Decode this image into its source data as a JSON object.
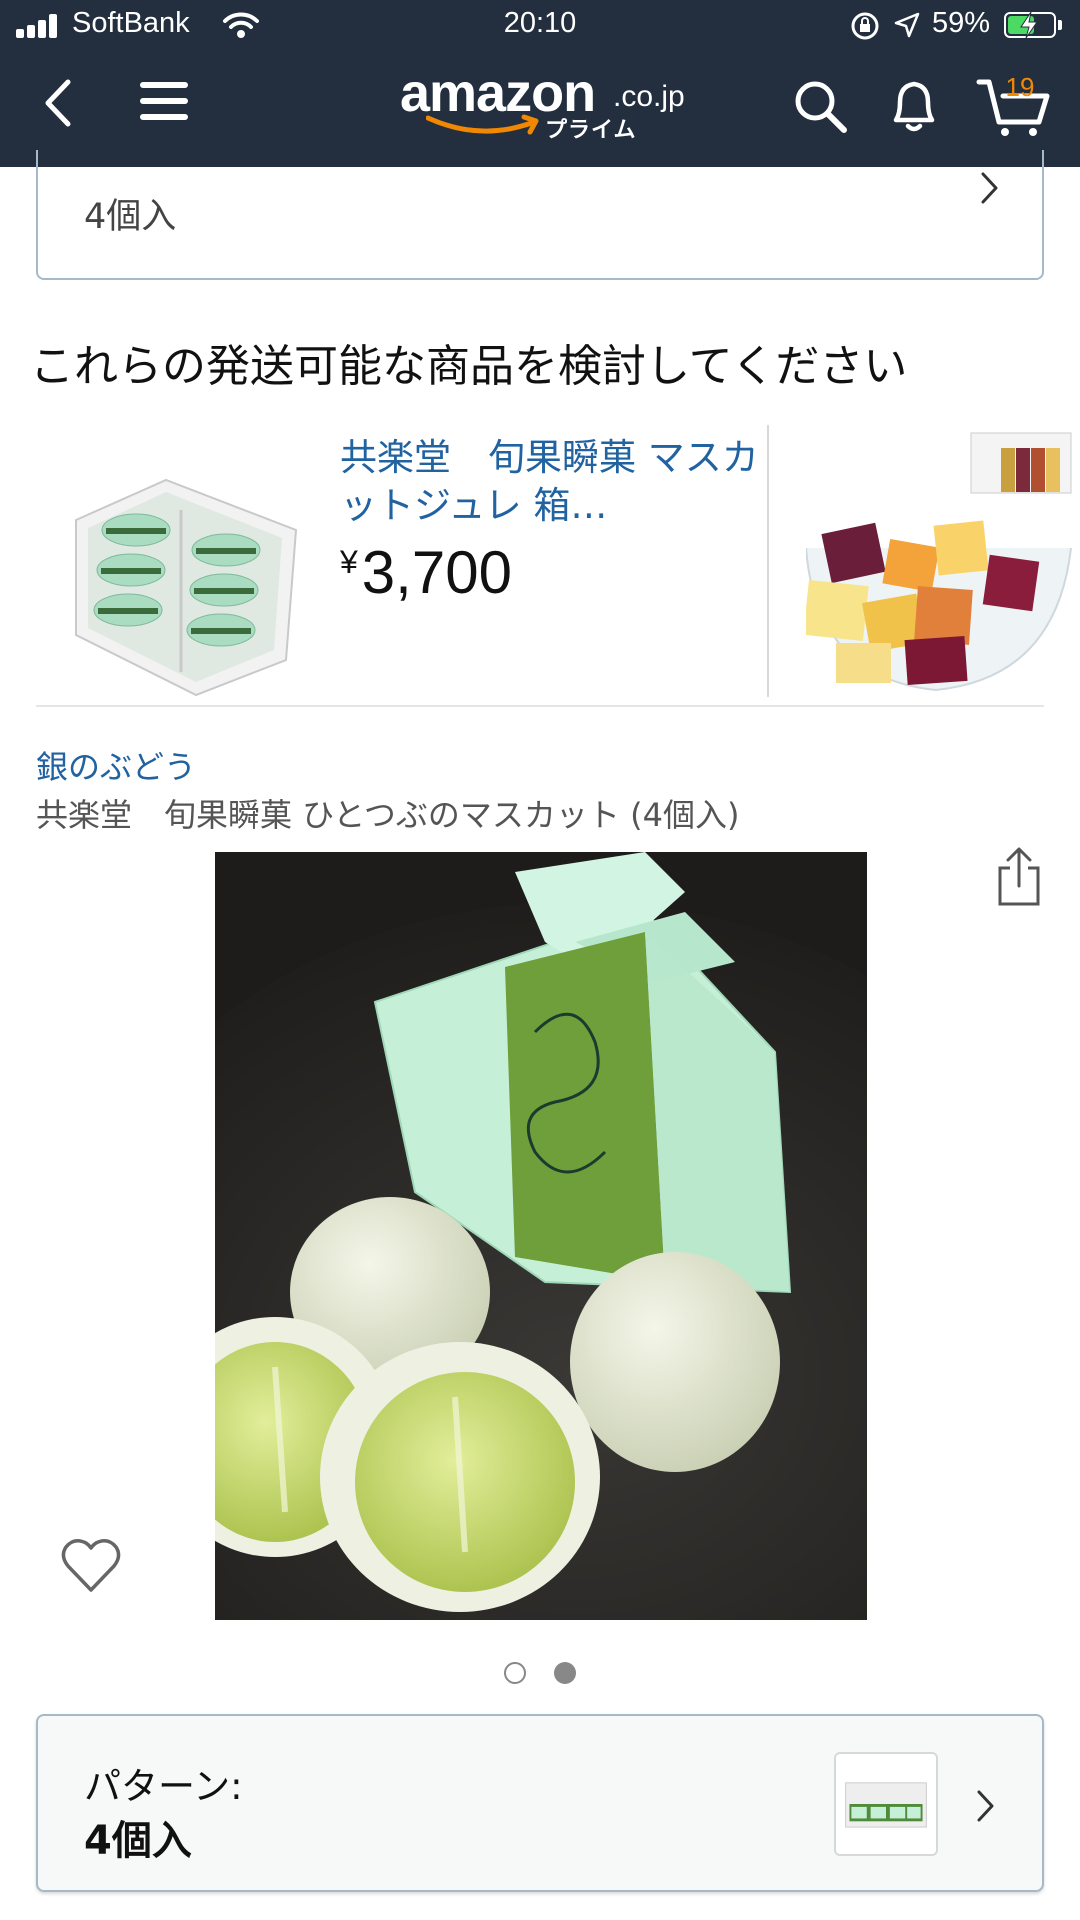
{
  "status_bar": {
    "carrier": "SoftBank",
    "time": "20:10",
    "battery_percent": "59%",
    "battery_level": 0.59,
    "icons": [
      "signal-icon",
      "wifi-icon",
      "rotation-lock-icon",
      "location-icon",
      "battery-icon"
    ]
  },
  "header": {
    "logo_word": "amazon",
    "logo_suffix": ".co.jp",
    "logo_prime": "プライム",
    "cart_count": "19",
    "icons": [
      "back-icon",
      "menu-icon",
      "search-icon",
      "bell-icon",
      "cart-icon"
    ]
  },
  "top_card": {
    "text": "4個入"
  },
  "consider": {
    "title": "これらの発送可能な商品を検討してください",
    "items": [
      {
        "title": "共楽堂　旬果瞬菓 マスカットジュレ 箱…",
        "price_symbol": "¥",
        "price": "3,700"
      }
    ]
  },
  "product": {
    "brand": "銀のぶどう",
    "title": "共楽堂　旬果瞬菓 ひとつぶのマスカット (4個入)",
    "image_count": 2,
    "active_image": 2
  },
  "pattern": {
    "label": "パターン:",
    "value": "4個入"
  },
  "colors": {
    "header_bg": "#232f3e",
    "link": "#2162a1",
    "cart_badge": "#f08804",
    "border": "#a6b9c8"
  }
}
